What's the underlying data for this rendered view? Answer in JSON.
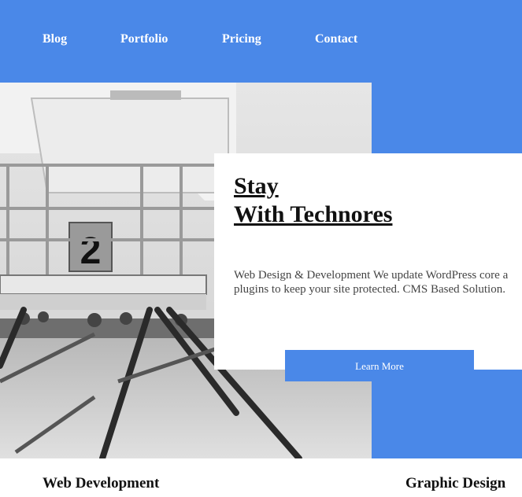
{
  "nav": {
    "items": [
      "Blog",
      "Portfolio",
      "Pricing",
      "Contact"
    ]
  },
  "hero": {
    "image_alt": "lifeguard tower",
    "tower_number": "2",
    "title_line1": "Stay",
    "title_line2": "With Technores",
    "description_line1": "Web Design & Development We update WordPress core a",
    "description_line2": "plugins to keep your site protected. CMS Based Solution.",
    "button_label": "Learn More"
  },
  "services": [
    "Web Development",
    "Graphic Design"
  ],
  "colors": {
    "accent": "#4a88e8",
    "card": "#ffffff",
    "text": "#111111"
  }
}
